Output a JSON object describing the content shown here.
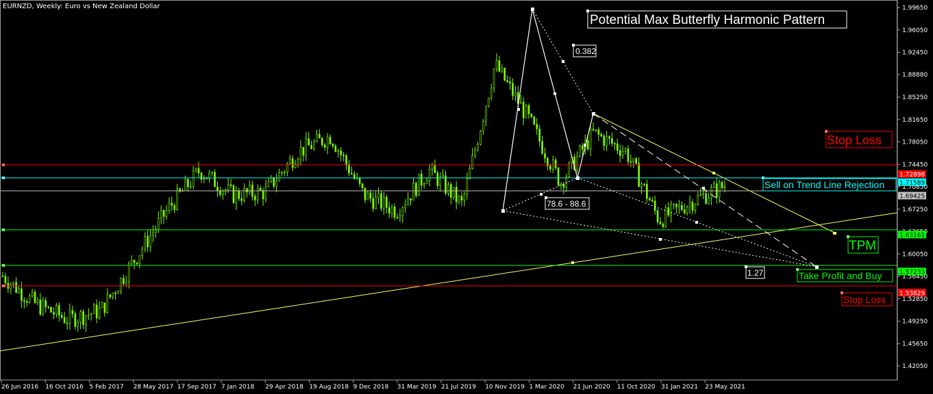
{
  "window": {
    "symbol_title": "EURNZD, Weekly:  Euro vs New Zealand Dollar"
  },
  "annotations": {
    "pattern_title": "Potential Max Butterfly Harmonic Pattern",
    "fib_382": "0.382",
    "fib_786_886": "78.6 - 88.6",
    "fib_127": "1.27",
    "sell_trend": "Sell on Trend Line Rejection",
    "stop_loss_upper": "Stop Loss",
    "stop_loss_lower": "Stop Loss",
    "tpm": "TPM",
    "take_profit": "Take Profit and Buy"
  },
  "colors": {
    "background": "#000000",
    "candle": "#7fff00",
    "red_line": "#ff0000",
    "cyan_line": "#00ffff",
    "green_line": "#00ff00",
    "gray_line": "#c0c0c0",
    "trend_yellow": "#ffff66",
    "pattern": "#ffffff"
  },
  "chart_data": {
    "type": "candlestick",
    "symbol": "EURNZD",
    "timeframe": "Weekly",
    "ylim": [
      1.4,
      2.0
    ],
    "y_ticks": [
      "1.99650",
      "1.96050",
      "1.92450",
      "1.88880",
      "1.85250",
      "1.81650",
      "1.78050",
      "1.74450",
      "1.70850",
      "1.67250",
      "1.63650",
      "1.60050",
      "1.56450",
      "1.52850",
      "1.49250",
      "1.45650",
      "1.42050"
    ],
    "x_ticks": [
      "26 Jun 2016",
      "16 Oct 2016",
      "5 Feb 2017",
      "28 May 2017",
      "17 Sep 2017",
      "7 Jan 2018",
      "29 Apr 2018",
      "19 Aug 2018",
      "9 Dec 2018",
      "31 Mar 2019",
      "21 Jul 2019",
      "10 Nov 2019",
      "1 Mar 2020",
      "21 Jun 2020",
      "11 Oct 2020",
      "31 Jan 2021",
      "23 May 2021"
    ],
    "price_close_path": [
      [
        "26 Jun 2016",
        1.565
      ],
      [
        "16 Oct 2016",
        1.52
      ],
      [
        "5 Feb 2017",
        1.495
      ],
      [
        "Mar 2017",
        1.51
      ],
      [
        "28 May 2017",
        1.59
      ],
      [
        "17 Sep 2017",
        1.67
      ],
      [
        "Oct 2017",
        1.735
      ],
      [
        "7 Jan 2018",
        1.695
      ],
      [
        "29 Apr 2018",
        1.7
      ],
      [
        "19 Aug 2018",
        1.765
      ],
      [
        "Sep 2018",
        1.79
      ],
      [
        "9 Dec 2018",
        1.695
      ],
      [
        "31 Mar 2019",
        1.67
      ],
      [
        "21 Jul 2019",
        1.735
      ],
      [
        "10 Nov 2019",
        1.68
      ],
      [
        "1 Mar 2020",
        1.905
      ],
      [
        "Apr 2020",
        1.82
      ],
      [
        "21 Jun 2020",
        1.715
      ],
      [
        "Jul 2020",
        1.795
      ],
      [
        "11 Oct 2020",
        1.765
      ],
      [
        "31 Jan 2021",
        1.655
      ],
      [
        "23 May 2021",
        1.685
      ],
      [
        "Aug 2021",
        1.71
      ]
    ],
    "horizontal_levels": [
      {
        "label": "1.72898",
        "value": 1.72898,
        "color": "#ff0000"
      },
      {
        "label": "1.71589",
        "value": 1.71589,
        "color": "#00ffff"
      },
      {
        "label": "1.69425",
        "value": 1.69425,
        "color": "#c0c0c0"
      },
      {
        "label": "1.63161",
        "value": 1.63161,
        "color": "#00ff00"
      },
      {
        "label": "1.57233",
        "value": 1.57233,
        "color": "#00ff00"
      },
      {
        "label": "1.53829",
        "value": 1.53829,
        "color": "#ff0000"
      }
    ],
    "harmonic_points": {
      "X": [
        "10 Nov 2019",
        1.667
      ],
      "A": [
        "1 Mar 2020",
        1.99
      ],
      "B": [
        "21 Jun 2020",
        1.712
      ],
      "C": [
        "21 Jun 2020",
        1.82
      ],
      "D": [
        "Nov 2021",
        1.57
      ]
    },
    "fib_labels": [
      "0.382",
      "78.6 - 88.6",
      "1.27"
    ]
  }
}
